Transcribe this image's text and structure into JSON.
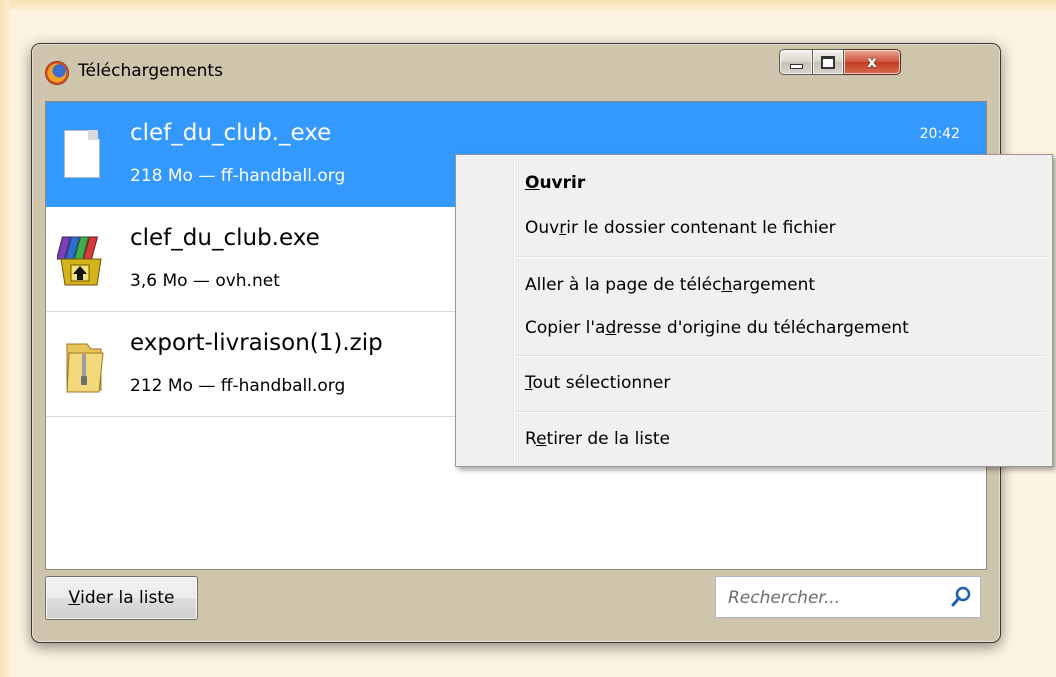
{
  "window": {
    "title": "Téléchargements",
    "caption_buttons": {
      "minimize_icon": "minimize-icon",
      "maximize_icon": "maximize-icon",
      "close_icon": "close-icon",
      "close_glyph": "x"
    }
  },
  "downloads": [
    {
      "name": "clef_du_club._exe",
      "meta": "218 Mo — ff-handball.org",
      "time": "20:42",
      "icon": "generic-file-icon",
      "selected": true
    },
    {
      "name": "clef_du_club.exe",
      "meta": "3,6 Mo — ovh.net",
      "time": "",
      "icon": "winrar-installer-icon",
      "selected": false
    },
    {
      "name": "export-livraison(1).zip",
      "meta": "212 Mo — ff-handball.org",
      "time": "",
      "icon": "zip-folder-icon",
      "selected": false
    }
  ],
  "footer": {
    "clear_button": {
      "pre": "",
      "mnemonic": "V",
      "post": "ider la liste"
    },
    "search": {
      "placeholder": "Rechercher...",
      "value": "",
      "icon": "search-icon"
    }
  },
  "context_menu": {
    "items": [
      {
        "pre": "",
        "mnemonic": "O",
        "post": "uvrir",
        "bold": true
      },
      {
        "pre": "Ouv",
        "mnemonic": "r",
        "post": "ir le dossier contenant le fichier",
        "bold": false
      },
      {
        "pre": "Aller à la page de téléc",
        "mnemonic": "h",
        "post": "argement",
        "bold": false
      },
      {
        "pre": "Copier l'a",
        "mnemonic": "d",
        "post": "resse d'origine du téléchargement",
        "bold": false
      },
      {
        "pre": "",
        "mnemonic": "T",
        "post": "out sélectionner",
        "bold": false
      },
      {
        "pre": "R",
        "mnemonic": "e",
        "post": "tirer de la liste",
        "bold": false
      }
    ]
  },
  "colors": {
    "selection": "#3399ff",
    "background": "#fdf3e1",
    "window_frame": "#cfc4ac",
    "close_button": "#c23c23"
  }
}
